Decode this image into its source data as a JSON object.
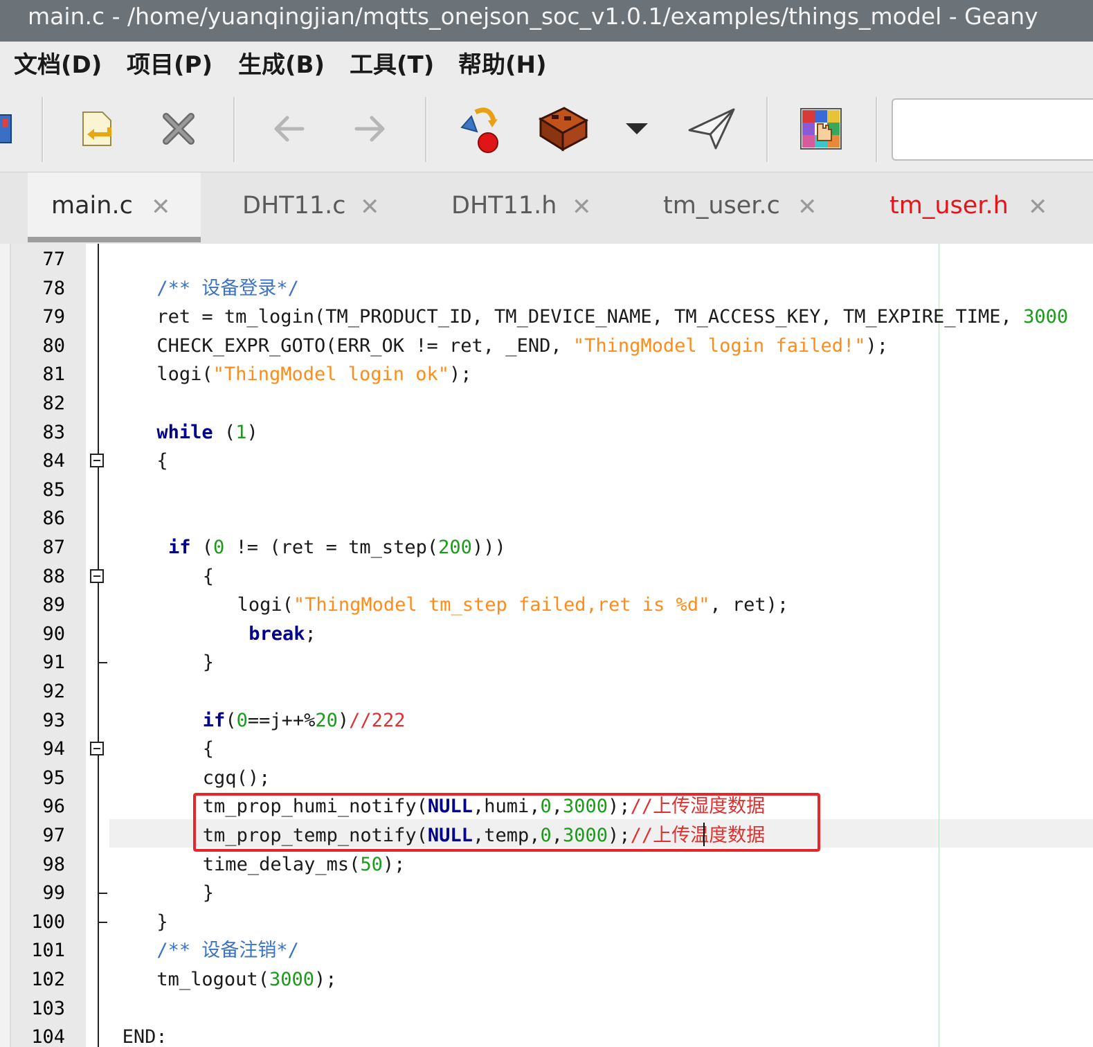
{
  "window": {
    "title": "main.c - /home/yuanqingjian/mqtts_onejson_soc_v1.0.1/examples/things_model - Geany"
  },
  "menu": [
    "文档(D)",
    "项目(P)",
    "生成(B)",
    "工具(T)",
    "帮助(H)"
  ],
  "toolbar": {
    "icons": [
      "save-icon",
      "revert-icon",
      "close-icon",
      "back-arrow-icon",
      "forward-arrow-icon",
      "compile-icon",
      "build-icon",
      "build-dropdown-icon",
      "execute-icon",
      "color-chooser-icon"
    ],
    "search_value": ""
  },
  "tabs": [
    {
      "label": "main.c",
      "active": true,
      "color": "#2b2b2b"
    },
    {
      "label": "DHT11.c",
      "active": false,
      "color": "#5a5a5a"
    },
    {
      "label": "DHT11.h",
      "active": false,
      "color": "#5a5a5a"
    },
    {
      "label": "tm_user.c",
      "active": false,
      "color": "#5a5a5a"
    },
    {
      "label": "tm_user.h",
      "active": false,
      "color": "#e8131a"
    }
  ],
  "editor": {
    "lines": [
      {
        "n": "77",
        "indent": 0,
        "tokens": []
      },
      {
        "n": "78",
        "indent": 4,
        "tokens": [
          {
            "t": "/** 设备登录*/",
            "c": "cmt"
          }
        ]
      },
      {
        "n": "79",
        "indent": 4,
        "tokens": [
          {
            "t": "ret = tm_login(TM_PRODUCT_ID, TM_DEVICE_NAME, TM_ACCESS_KEY, TM_EXPIRE_TIME, ",
            "c": "plain"
          },
          {
            "t": "3000",
            "c": "num"
          }
        ]
      },
      {
        "n": "80",
        "indent": 4,
        "tokens": [
          {
            "t": "CHECK_EXPR_GOTO(ERR_OK != ret, _END, ",
            "c": "plain"
          },
          {
            "t": "\"ThingModel login failed!\"",
            "c": "str"
          },
          {
            "t": ");",
            "c": "plain"
          }
        ]
      },
      {
        "n": "81",
        "indent": 4,
        "tokens": [
          {
            "t": "logi(",
            "c": "plain"
          },
          {
            "t": "\"ThingModel login ok\"",
            "c": "str"
          },
          {
            "t": ");",
            "c": "plain"
          }
        ]
      },
      {
        "n": "82",
        "indent": 0,
        "tokens": []
      },
      {
        "n": "83",
        "indent": 4,
        "tokens": [
          {
            "t": "while",
            "c": "kw"
          },
          {
            "t": " (",
            "c": "plain"
          },
          {
            "t": "1",
            "c": "num"
          },
          {
            "t": ")",
            "c": "plain"
          }
        ]
      },
      {
        "n": "84",
        "indent": 4,
        "tokens": [
          {
            "t": "{",
            "c": "plain"
          }
        ]
      },
      {
        "n": "85",
        "indent": 0,
        "tokens": []
      },
      {
        "n": "86",
        "indent": 0,
        "tokens": []
      },
      {
        "n": "87",
        "indent": 5,
        "tokens": [
          {
            "t": "if",
            "c": "kw"
          },
          {
            "t": " (",
            "c": "plain"
          },
          {
            "t": "0",
            "c": "num"
          },
          {
            "t": " != (ret = tm_step(",
            "c": "plain"
          },
          {
            "t": "200",
            "c": "num"
          },
          {
            "t": ")))",
            "c": "plain"
          }
        ]
      },
      {
        "n": "88",
        "indent": 8,
        "tokens": [
          {
            "t": "{",
            "c": "plain"
          }
        ]
      },
      {
        "n": "89",
        "indent": 11,
        "tokens": [
          {
            "t": "logi(",
            "c": "plain"
          },
          {
            "t": "\"ThingModel tm_step failed,ret is %d\"",
            "c": "str"
          },
          {
            "t": ", ret);",
            "c": "plain"
          }
        ]
      },
      {
        "n": "90",
        "indent": 12,
        "tokens": [
          {
            "t": "break",
            "c": "kw"
          },
          {
            "t": ";",
            "c": "plain"
          }
        ]
      },
      {
        "n": "91",
        "indent": 8,
        "tokens": [
          {
            "t": "}",
            "c": "plain"
          }
        ]
      },
      {
        "n": "92",
        "indent": 0,
        "tokens": []
      },
      {
        "n": "93",
        "indent": 8,
        "tokens": [
          {
            "t": "if",
            "c": "kw"
          },
          {
            "t": "(",
            "c": "plain"
          },
          {
            "t": "0",
            "c": "num"
          },
          {
            "t": "==j++%",
            "c": "plain"
          },
          {
            "t": "20",
            "c": "num"
          },
          {
            "t": ")",
            "c": "plain"
          },
          {
            "t": "//222",
            "c": "cmt-red"
          }
        ]
      },
      {
        "n": "94",
        "indent": 8,
        "tokens": [
          {
            "t": "{",
            "c": "plain"
          }
        ]
      },
      {
        "n": "95",
        "indent": 8,
        "tokens": [
          {
            "t": "cgq();",
            "c": "plain"
          }
        ]
      },
      {
        "n": "96",
        "indent": 8,
        "tokens": [
          {
            "t": "tm_prop_humi_notify(",
            "c": "plain"
          },
          {
            "t": "NULL",
            "c": "kw"
          },
          {
            "t": ",humi,",
            "c": "plain"
          },
          {
            "t": "0",
            "c": "num"
          },
          {
            "t": ",",
            "c": "plain"
          },
          {
            "t": "3000",
            "c": "num"
          },
          {
            "t": ");",
            "c": "plain"
          },
          {
            "t": "//上传湿度数据",
            "c": "cmt-red"
          }
        ]
      },
      {
        "n": "97",
        "indent": 8,
        "tokens": [
          {
            "t": "tm_prop_temp_notify(",
            "c": "plain"
          },
          {
            "t": "NULL",
            "c": "kw"
          },
          {
            "t": ",temp,",
            "c": "plain"
          },
          {
            "t": "0",
            "c": "num"
          },
          {
            "t": ",",
            "c": "plain"
          },
          {
            "t": "3000",
            "c": "num"
          },
          {
            "t": ");",
            "c": "plain"
          },
          {
            "t": "//上传温度数据",
            "c": "cmt-red"
          }
        ]
      },
      {
        "n": "98",
        "indent": 8,
        "tokens": [
          {
            "t": "time_delay_ms(",
            "c": "plain"
          },
          {
            "t": "50",
            "c": "num"
          },
          {
            "t": ");",
            "c": "plain"
          }
        ]
      },
      {
        "n": "99",
        "indent": 8,
        "tokens": [
          {
            "t": "}",
            "c": "plain"
          }
        ]
      },
      {
        "n": "100",
        "indent": 4,
        "tokens": [
          {
            "t": "}",
            "c": "plain"
          }
        ]
      },
      {
        "n": "101",
        "indent": 4,
        "tokens": [
          {
            "t": "/** 设备注销*/",
            "c": "cmt"
          }
        ]
      },
      {
        "n": "102",
        "indent": 4,
        "tokens": [
          {
            "t": "tm_logout(",
            "c": "plain"
          },
          {
            "t": "3000",
            "c": "num"
          },
          {
            "t": ");",
            "c": "plain"
          }
        ]
      },
      {
        "n": "103",
        "indent": 0,
        "tokens": []
      },
      {
        "n": "104",
        "indent": 1,
        "tokens": [
          {
            "t": "END:",
            "c": "plain"
          }
        ]
      }
    ],
    "fold_markers": [
      "84",
      "88",
      "94"
    ],
    "fold_ends": [
      "91",
      "99",
      "100"
    ],
    "current_line": "97",
    "highlighted_lines": [
      "96",
      "97"
    ]
  }
}
